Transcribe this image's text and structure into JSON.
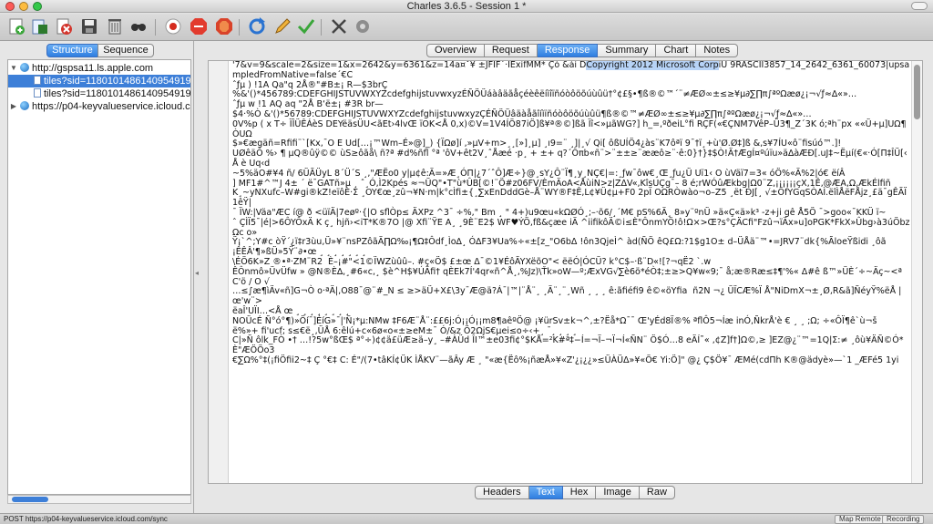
{
  "window": {
    "title": "Charles 3.6.5 - Session 1 *"
  },
  "toolbar": {
    "icons": [
      "new-session",
      "open",
      "close",
      "save",
      "clear",
      "find",
      "record",
      "stop",
      "refresh",
      "edit",
      "validate",
      "tools",
      "settings"
    ]
  },
  "left": {
    "view_tabs": [
      "Structure",
      "Sequence"
    ],
    "tree": [
      {
        "label": "http://gspsa11.ls.apple.com"
      },
      {
        "label": "tiles?sid=11801014861409549191"
      },
      {
        "label": "tiles?sid=11801014861409549191"
      },
      {
        "label": "https://p04-keyvalueservice.icloud.com"
      }
    ]
  },
  "right": {
    "tabs": [
      "Overview",
      "Request",
      "Response",
      "Summary",
      "Chart",
      "Notes"
    ],
    "active_tab": "Response",
    "subtabs": [
      "Headers",
      "Text",
      "Hex",
      "Image",
      "Raw"
    ],
    "active_subtab": "Text",
    "lines": [
      {
        "n": "1",
        "pre": "'7&v=9&scale=2&size=1&x=2642&y=6361&z=14a¤ˇ¥ ±JFIF´·ÏExifMM* Çò &ái D",
        "hl": "Copyright 2012 Microsoft Corp",
        "post": "iU 9RASCII3857_14_2642_6361_60073|upsampledFromNative=false´€C"
      },
      {
        "n": "2",
        "pre": "ˆƒµ ) !1A Qa\"q 2Å®\"#B±¡ R—$3brÇ",
        "hl": "",
        "post": ""
      },
      {
        "n": "3",
        "pre": "%&'()*456789:CDEFGHIJSTUVWXYZcdefghijstuvwxyzÉÑÖÜáàâäãåçéèêëíìîïñóòôöõúùûü†°¢£§•¶ß®©™´¨≠ÆØ∞±≤≥¥µ∂∑∏π∫ªºΩæø¿¡¬√ƒ≈∆«»…",
        "hl": "",
        "post": ""
      },
      {
        "n": "4",
        "pre": "ˆƒµ w !1 AQ aq \"2Å B‘ë±¡ #3R br—",
        "hl": "",
        "post": ""
      },
      {
        "n": "5",
        "pre": "$4·%Ò &'()*56789:CDEFGHIJSTUVWXYZcdefghijstuvwxyzÇÉÑÖÜâäàåãîíìïñóòôöõúùûü¶ß®©™≠ÆØ∞±≤≥¥µ∂∑∏π∫ªºΩæø¿¡¬√ƒ≈∆«»…",
        "hl": "",
        "post": ""
      },
      {
        "n": "6",
        "pre": "0V%p ( x T÷ ÏÎÜÊÁèS DEYëäsÜU<ãEt›4lvŒ ïOK<Å 0,x)©V=1V4ÍÖ87iÖ]ß¥ª®©]ßã Ïî<»µãWG?] h_=,ºðeiL°fi RÇF(«€ÇNM7VêP–Ü3¶_Z´3K ó;ªh¨px ««Ü+µ]UΩ¶ÒUΩ",
        "hl": "",
        "post": ""
      },
      {
        "n": "7",
        "pre": "$»€ægäñ=Rfifi¨`[Kx,¯O E Ud[…¡™Wm–É»@]_) {ÏΩø]í ,»µV+m>¸¸[»]¸µ] ¸ı9=¨ ¸]|¸√ Qi[ ôßUÍÖ4¿às¨K7ôªï 9¯†ï¸+ù'Ø.Ø‡]ß &,s¥7ÍU«ô¨fisúó™.]!",
        "hl": "",
        "post": ""
      },
      {
        "n": "8",
        "pre": "UØêäÔ %› ¶ µQ®ûÿ©© ùS≥ôãå\\ ñ?ª #d%ñfl °ª 'ôV+êt2V¸ˆÅæé ·p¸ + ±+ q?´Ôπb«ñ¨>¨±±≥¨ææô≥¨·ê:0}†}‡$Ò!Ä†ÆgÍ¤ºúïu»ä∆àÆÐ[.uJ‡~Ëµí(€«·Ó[Π‡ÎÜ[‹ Å è Uq‹d",
        "hl": "",
        "post": ""
      },
      {
        "n": "9",
        "pre": "~5%äO#¥4 ñ/ 6ÜÃÜyL 8´Ü´S ¸,\"ÆËo0 y|µ¢ê:Ä=»Æ¸ÓΠ|¿7´ˆÔ]Æ÷}@¸sY¿Ô¨Ï¶¸y¸NÇ€|=:¸ƒw¯ôw€¸Œ¸ƒu¿Ü Uï1‹ O ùVäï7=3« óÖ%«Ä%2|ó€ ëíÂ",
        "hl": "",
        "post": ""
      },
      {
        "n": "10",
        "pre": "] MF1#^™J 4± ´ ë¯GATñ»µ ¸ ˆ¸Ó,Ì2Kpés ≈¬ÜQ\"•T\"ù*ÛB[©!¨Ö#z06FV/ÈmÄoA<ÅùiN>z|ZΔV«,KîsUÇg¯– 8 é;rWÓûÆkbg|Ω0¨Z‚¡¡¡¡¡¡çX‚1Ê‚@ÆA‚Ω‚ÆkÉlfiñ",
        "hl": "",
        "post": ""
      },
      {
        "n": "11",
        "pre": "K¸~yNXufc–W#gi®kZ!eïôÈ·Σ ¸OY€œ¸zû¬¥N·m|k°cÌfi±{¸∑xEnDddGè–Å¨WY®F‡Ê,L¢¥Ü¢µ+F0 2pÏ OΩRÒwàο¬o–Z5 ¸ët ÐJ[¸ √±ÕfYGqSÒAÌ.ëîÌÅëFÅjz¸£ä¯gÊÃÏ 1êŸ|",
        "hl": "",
        "post": ""
      },
      {
        "n": "12",
        "pre": "¯ ÏW:|Väa\"ÆC í@ ð <üïÄ|7eøº·{|O sflÒp≤ ÄXPz ^3¯ ÷%,\" Bm ¸ \" 4+)u9œu«kΩØÓ¸;–·õ6/¸´M€ pS%6Ä¸ 8»y¨ºnÜ »ä«Ç«ä»k³ -z+ji gê Å5Ö ¯>goo«¯KKÜ ï~",
        "hl": "",
        "post": ""
      },
      {
        "n": "13",
        "pre": "ˆ ÇÌÏ5¯|é|>6ÔYÔxÄ K ç¸ hjñ›<iT*K®7O |@ Xfi¨ŸE A¸ ¸9È¨E2$ WF♥ÝÖ,fß&çæe iÄ ^iifikôÄ©i≤È\"ÔnmYÖ!ô!Ω×>Œ?s°ÇÄCfi\"Fzû¬ïÄx»u]oPGK*FkX»Ûbg›à3úÖbz Ωc o»",
        "hl": "",
        "post": ""
      },
      {
        "n": "14",
        "pre": "Ÿ¡`^;Y#c òŸ´¿ï‡r3ùu,Ü»¥¨nsPZôãÄ∏Ω‰¡¶Ω‡Ôdf¸Ìo∆¸ Ó∆F3¥Ua%÷«±[z_\"O6bΔ !ôn3QjeÌ^ àd(ÑÖ êQ£Ω:?1$g1O± d–ÜÅä¨™•=JRV7¨dk{%ÃloeŸßidi ¸ôã",
        "hl": "",
        "post": ""
      },
      {
        "n": "15",
        "pre": "¡ÊÊÂ'¶»ßÜ»5Ÿ¨∂•œ ¸ ¸ ¸ ¸ ¸ ¸ ¸",
        "hl": "",
        "post": ""
      },
      {
        "n": "16",
        "pre": "\\ÉÖ6K»Z ®•ª·ZM¨R2  È–¡#\"<1©ÏWZùûû–. #ç«Ö$ £±œ Δ¯©1¥ÉôÃYXëõO\"< ëëÓ|ÓCÜ? k°C$–·ß¨D«![?¬qË2 `.w",
        "hl": "",
        "post": ""
      },
      {
        "n": "17",
        "pre": "ÊÔnmô»ÜvÜfw » @N®È∆,¸#6«c,¸ $è^H$¥ÚÄfi† qÈEk7Í'4qr«ñ^Å¸‚%Jz)\\Ťk»oW—º;ÆxVG√∑è6ö*éÒ‡;±≥>Q¥w«9;¯ å;æ®Ræ≤‡¶'%« Δ#ê ß™»ÜÈ´÷~Äç~<ªC'ö / O √",
        "hl": "",
        "post": ""
      },
      {
        "n": "18",
        "pre": "…≤∫æ¶ìÄv«ñ]G¬Ò o·ªÄ|,O88¯@¨#_N ≤ ≥>äÜ+X£\\3y¯Æ@ä?Á¯|™|¨Å¨¸ ¸Ä¨¸¨¸Wñ ¸ ¸ ¸ ê:ãfiéfi9 ê©«öYfia  ñ2N ¬¿ ÜÏCÆ%Ï Å\"NiDmX¬±¸Ø,R&ã]ÑéyŸ%ëÅ |œ'w¨>",
        "hl": "",
        "post": ""
      },
      {
        "n": "19",
        "pre": "ëaÎ'UÏI…<Å œ ¸ ¸ ¸ ¸ ¸ ¸ ¸ ¸",
        "hl": "",
        "post": ""
      },
      {
        "n": "20",
        "pre": "NOÜcÉ Ñ°ó°¶)»Öí¯]ÉíG»¯|'Ñ¡*µ:NMw ‡F6Æ¨Å¨:££6j:Ó¡¡Ó¡¡m8¶aêºÖ@ ¡¥ürSv±k¬^‚±?Ëå*Ω¯¯ Œ'yÉd8Ï®% ªflÔ5¬Íæ inÓ,ÑkrÅ'è € ¸ ¸ ;Ω; ÷«ÔÏ¶ê`ù¬š",
        "hl": "",
        "post": ""
      },
      {
        "n": "21",
        "pre": "ë%»+ fi'ucf; s≤€ë¸,ÜÅ 6:êlú+c«6ø«o«±≥eM±¯ Ó/&z Ö2ΩjS€µei≤o÷‹+¸ ¯¸ ¸ ¸ ¸",
        "hl": "",
        "post": ""
      },
      {
        "n": "22",
        "pre": "C|»Ñ ôlk_FÒ •† …!?5w°ßŒ$ ª°÷)¢¢ä£üÆ≥ä–y¸ –#ÀÜd ÎI™±e03fi¢°$KÅ=²K#ª‡−Í=¬Ï–¬Ï¬Í«ÑN¨ Ö$Ó…8 eÄÍ˜« ,¢Z]f†]Ω©,≥ ]EZ@¿¨™=1Q|Σ:≠ ¸ôù¥ÄÑ©Ó*È\"ÆÖÖo3",
        "hl": "",
        "post": ""
      },
      {
        "n": "23",
        "pre": "€∑Ω%°‡(¡fiÖfii2~‡ Ç °€‡ C: É\"/(7•tâKÍ¢ÜK ÌÅKV¨—ãÂy Æ ¸ \"«æ{Ëô%¡ñæÅ»¥«Z'¿¡¿¿»≤ÜÀÜΔ»¥«Ö€ Yi:Ö]\" @¿ Ç$Ö¥¯ ÆMé(cdΠh K®@ädyè»—`1 _ÆFé5 1yi",
        "hl": "",
        "post": ""
      }
    ]
  },
  "status": {
    "text": "POST https://p04-keyvalueservice.icloud.com/sync",
    "buttons": [
      "Map Remote",
      "Recording"
    ]
  },
  "colors": {
    "accent": "#3d7fd8",
    "selection": "#b7d3f7"
  }
}
